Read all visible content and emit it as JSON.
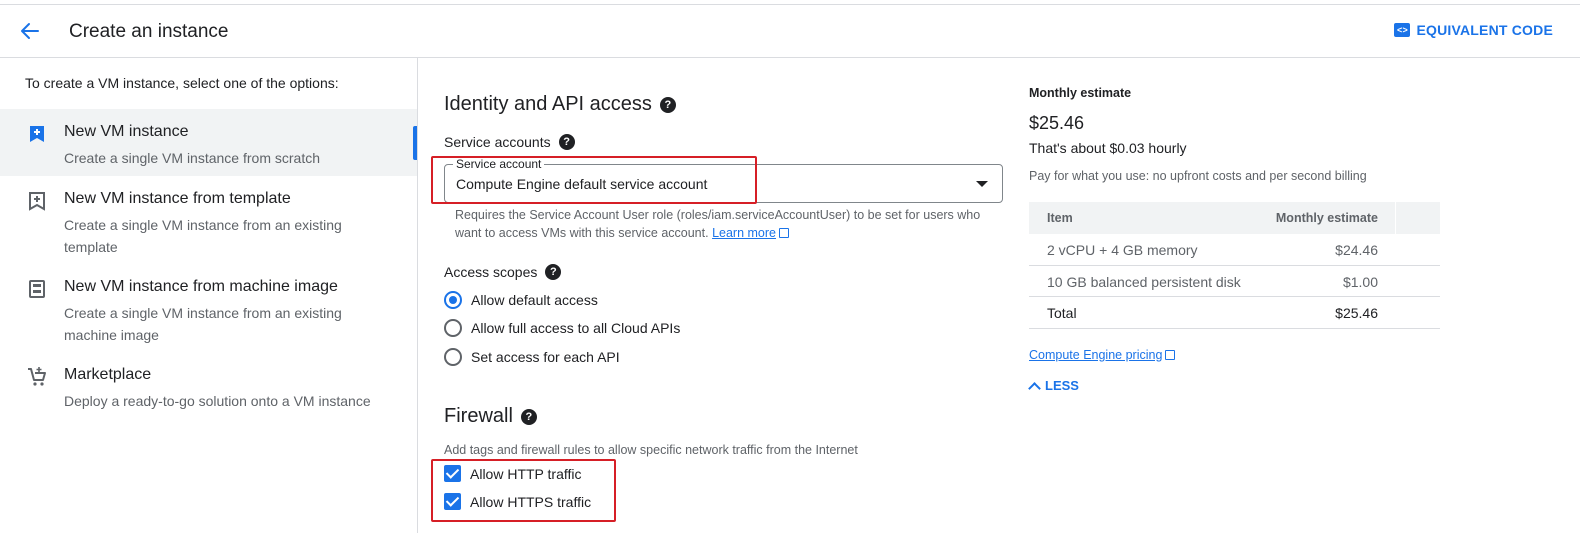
{
  "header": {
    "title": "Create an instance",
    "equivalent_code": "EQUIVALENT CODE"
  },
  "left": {
    "intro": "To create a VM instance, select one of the options:",
    "options": [
      {
        "title": "New VM instance",
        "desc": "Create a single VM instance from scratch",
        "icon": "add-box-icon",
        "selected": true
      },
      {
        "title": "New VM instance from template",
        "desc": "Create a single VM instance from an existing template",
        "icon": "template-icon",
        "selected": false
      },
      {
        "title": "New VM instance from machine image",
        "desc": "Create a single VM instance from an existing machine image",
        "icon": "machine-image-icon",
        "selected": false
      },
      {
        "title": "Marketplace",
        "desc": "Deploy a ready-to-go solution onto a VM instance",
        "icon": "cart-icon",
        "selected": false
      }
    ]
  },
  "identity": {
    "heading": "Identity and API access",
    "service_accounts_label": "Service accounts",
    "service_account_legend": "Service account",
    "service_account_value": "Compute Engine default service account",
    "help_text": "Requires the Service Account User role (roles/iam.serviceAccountUser) to be set for users who want to access VMs with this service account.",
    "learn_more": "Learn more",
    "access_scopes_label": "Access scopes",
    "scopes": [
      {
        "label": "Allow default access",
        "selected": true
      },
      {
        "label": "Allow full access to all Cloud APIs",
        "selected": false
      },
      {
        "label": "Set access for each API",
        "selected": false
      }
    ]
  },
  "firewall": {
    "heading": "Firewall",
    "description": "Add tags and firewall rules to allow specific network traffic from the Internet",
    "http_label": "Allow HTTP traffic",
    "https_label": "Allow HTTPS traffic"
  },
  "estimate": {
    "title": "Monthly estimate",
    "amount": "$25.46",
    "hourly": "That's about $0.03 hourly",
    "note": "Pay for what you use: no upfront costs and per second billing",
    "col_item": "Item",
    "col_estimate": "Monthly estimate",
    "rows": [
      {
        "item": "2 vCPU + 4 GB memory",
        "cost": "$24.46"
      },
      {
        "item": "10 GB balanced persistent disk",
        "cost": "$1.00"
      }
    ],
    "total_label": "Total",
    "total_value": "$25.46",
    "pricing_link": "Compute Engine pricing",
    "less_label": "LESS"
  },
  "colors": {
    "accent": "#1a73e8",
    "highlight": "#d61f26"
  }
}
